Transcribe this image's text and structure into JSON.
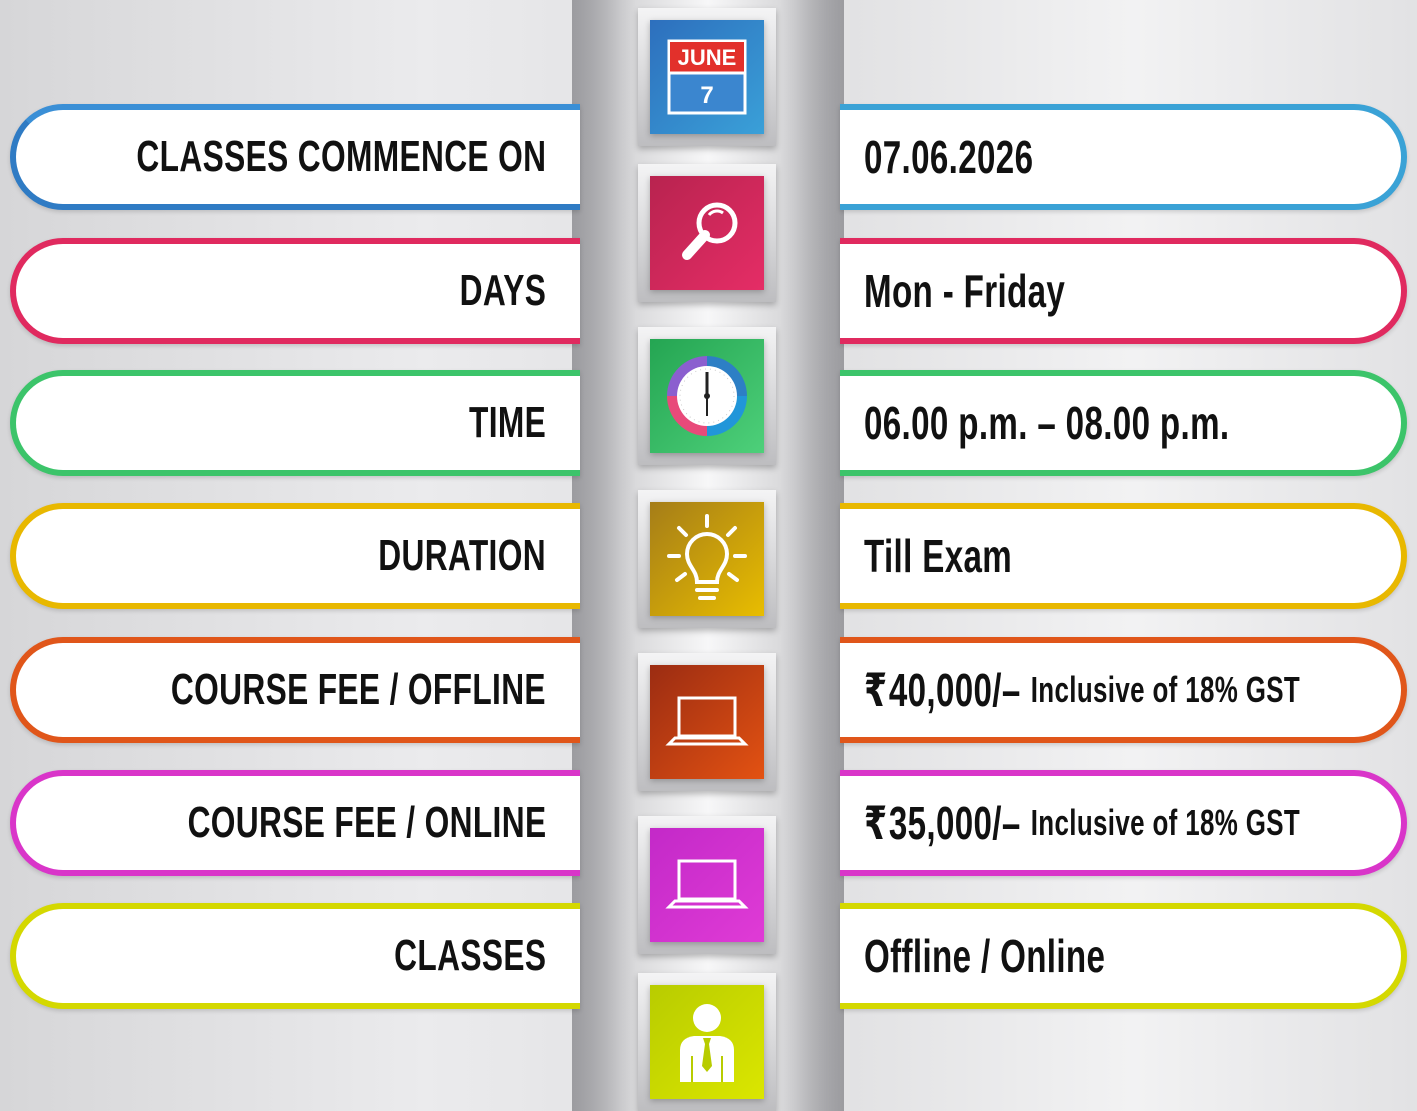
{
  "rows": [
    {
      "label": "CLASSES COMMENCE ON",
      "value": "07.06.2026",
      "color": "#2f7bc4",
      "icon": "calendar-icon"
    },
    {
      "label": "DAYS",
      "value": "Mon -  Friday",
      "color": "#e02a5f",
      "icon": "magnifier-icon"
    },
    {
      "label": "TIME",
      "value": "06.00 p.m. – 08.00 p.m.",
      "color": "#3cc46a",
      "icon": "clock-icon"
    },
    {
      "label": "DURATION",
      "value": "Till Exam",
      "color": "#e8b800",
      "icon": "lightbulb-icon"
    },
    {
      "label": "COURSE FEE  / OFFLINE",
      "rupee": "₹",
      "value": "40,000/–",
      "note": "Inclusive of 18% GST",
      "color": "#e0561a",
      "icon": "laptop-icon"
    },
    {
      "label": "COURSE FEE / ONLINE",
      "rupee": "₹",
      "value": "35,000/–",
      "note": "Inclusive of 18% GST",
      "color": "#d935c9",
      "icon": "laptop-icon"
    },
    {
      "label": "CLASSES",
      "value": "Offline / Online",
      "color": "#c9d400",
      "icon": "person-icon"
    }
  ],
  "calendar": {
    "month": "JUNE",
    "day": "7"
  }
}
